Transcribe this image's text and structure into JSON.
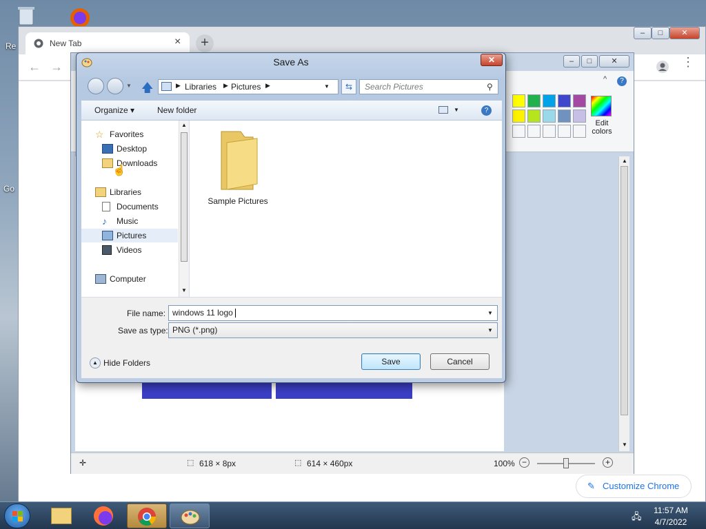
{
  "desktop": {
    "icon_labels": [
      "Re",
      "Go"
    ]
  },
  "chrome": {
    "tab_title": "New Tab",
    "tab_close": "×",
    "new_tab": "+",
    "customize_label": "Customize Chrome"
  },
  "paint": {
    "edit_colors": "Edit\ncolors",
    "status": {
      "selection_size": "618 × 8px",
      "canvas_size": "614 × 460px",
      "zoom": "100%"
    },
    "palette": [
      "#ffff00",
      "#22b14c",
      "#00a2e8",
      "#3f48cc",
      "#a349a4",
      "#fff200",
      "#b5e61d",
      "#99d9ea",
      "#7092be",
      "#c8bfe7"
    ]
  },
  "dialog": {
    "title": "Save As",
    "close_glyph": "✕",
    "breadcrumb": [
      "Libraries",
      "Pictures"
    ],
    "search_placeholder": "Search Pictures",
    "organize_label": "Organize ▾",
    "new_folder_label": "New folder",
    "nav": {
      "favorites": "Favorites",
      "desktop": "Desktop",
      "downloads": "Downloads",
      "libraries": "Libraries",
      "documents": "Documents",
      "music": "Music",
      "pictures": "Pictures",
      "videos": "Videos",
      "computer": "Computer"
    },
    "folder_item": "Sample Pictures",
    "file_name_label": "File name:",
    "file_name_value": "windows 11 logo",
    "save_type_label": "Save as type:",
    "save_type_value": "PNG (*.png)",
    "hide_folders": "Hide Folders",
    "save_button": "Save",
    "cancel_button": "Cancel"
  },
  "taskbar": {
    "time": "11:57 AM",
    "date": "4/7/2022"
  }
}
